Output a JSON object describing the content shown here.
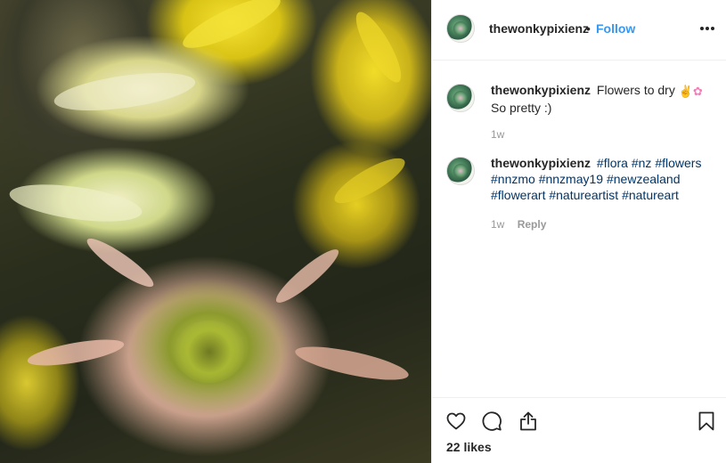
{
  "post": {
    "username": "thewonkypixienz",
    "separator": "•",
    "follow_label": "Follow",
    "likes_text": "22 likes"
  },
  "comments": [
    {
      "username": "thewonkypixienz",
      "text": "Flowers to dry",
      "emojis": [
        "✌",
        "✿"
      ],
      "text_line2": "So pretty :)",
      "age": "1w"
    },
    {
      "username": "thewonkypixienz",
      "hashtags": [
        "#flora",
        "#nz",
        "#flowers",
        "#nnzmo",
        "#nnzmay19",
        "#newzealand",
        "#flowerart",
        "#natureartist",
        "#natureart"
      ],
      "age": "1w",
      "reply_label": "Reply"
    }
  ],
  "icons": {
    "more": "more-options-icon",
    "like": "heart-icon",
    "comment": "comment-icon",
    "share": "share-icon",
    "save": "bookmark-icon"
  },
  "colors": {
    "follow_blue": "#3897f0",
    "hashtag_blue": "#003569",
    "meta_grey": "#999999",
    "text": "#262626"
  }
}
